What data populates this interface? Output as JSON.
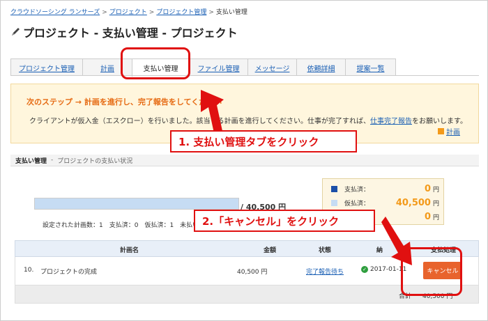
{
  "breadcrumb": {
    "items": [
      "クラウドソーシング ランサーズ",
      "プロジェクト",
      "プロジェクト管理"
    ],
    "current": "支払い管理",
    "separator": ">"
  },
  "page": {
    "title": "プロジェクト - 支払い管理 - プロジェクト"
  },
  "tabs": [
    {
      "label": "プロジェクト管理"
    },
    {
      "label": "計画"
    },
    {
      "label": "支払い管理"
    },
    {
      "label": "ファイル管理"
    },
    {
      "label": "メッセージ"
    },
    {
      "label": "依頼詳細"
    },
    {
      "label": "提案一覧"
    }
  ],
  "notice": {
    "heading": "次のステップ → 計画を進行し、完了報告をしてください",
    "body_before": "クライアントが仮入金（エスクロー）を行いました。該当する計画を進行してください。仕事が完了すれば、",
    "body_link": "仕事完了報告",
    "body_after": "をお願いします。",
    "plan_link": "計画"
  },
  "section": {
    "title": "支払い管理",
    "sep": "-",
    "subtitle": "プロジェクトの支払い状況"
  },
  "progress": {
    "total_label": "/ 40,500 円",
    "counts": "設定された計画数：1　支払済：0　仮払済：1　未払い",
    "fill_fraction": 1.0
  },
  "summary": {
    "unit": "円",
    "rows": [
      {
        "label": "支払済：",
        "value": "0",
        "color": "#1b4fa8"
      },
      {
        "label": "仮払済：",
        "value": "40,500",
        "color": "#c6dcf3"
      },
      {
        "label": "",
        "value": "0",
        "color": "#dddddd"
      }
    ]
  },
  "table": {
    "headers": {
      "name": "計画名",
      "amount": "金額",
      "status": "状態",
      "date": "納",
      "action": "支払処理"
    },
    "row": {
      "no": "10.",
      "name": "プロジェクトの完成",
      "amount": "40,500 円",
      "status": "完了報告待ち",
      "date": "2017-01-11",
      "cancel": "キャンセル"
    },
    "footer": {
      "label": "合計",
      "value": "40,500 円"
    }
  },
  "annotations": {
    "step1": "1. 支払い管理タブをクリック",
    "step2": "2.「キャンセル」をクリック",
    "color": "#e01010"
  }
}
